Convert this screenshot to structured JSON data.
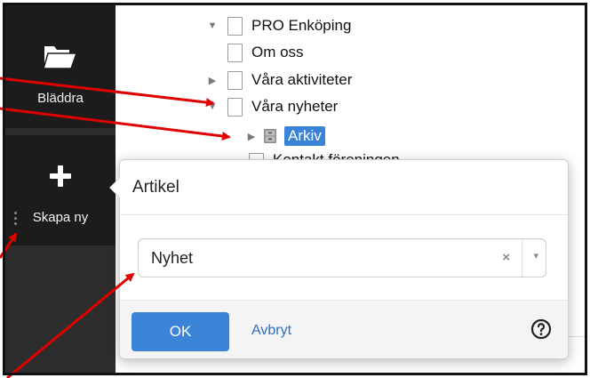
{
  "toolbar": {
    "browse_label": "Bläddra",
    "browse_icon": "folder-icon",
    "create_label": "Skapa ny",
    "create_icon": "plus-icon"
  },
  "tree": {
    "root": "PRO Enköping",
    "items": [
      {
        "label": "Om oss",
        "expandable": false
      },
      {
        "label": "Våra aktiviteter",
        "expandable": true,
        "expanded": false
      },
      {
        "label": "Våra nyheter",
        "expandable": true,
        "expanded": true
      },
      {
        "label": "Arkiv",
        "expandable": true,
        "expanded": false,
        "selected": true,
        "icon": "archive-icon"
      }
    ],
    "partial_label": "Kontakt föreningen"
  },
  "dialog": {
    "title": "Artikel",
    "select_value": "Nyhet",
    "clear_symbol": "×",
    "caret_symbol": "▾",
    "ok_label": "OK",
    "cancel_label": "Avbryt",
    "help_icon": "help-icon"
  },
  "colors": {
    "toolbar_bg": "#2d2d2d",
    "button_bg": "#1c1c1c",
    "accent": "#3a83d6",
    "link": "#2c6fc1",
    "annotation_arrow": "#e00000"
  }
}
